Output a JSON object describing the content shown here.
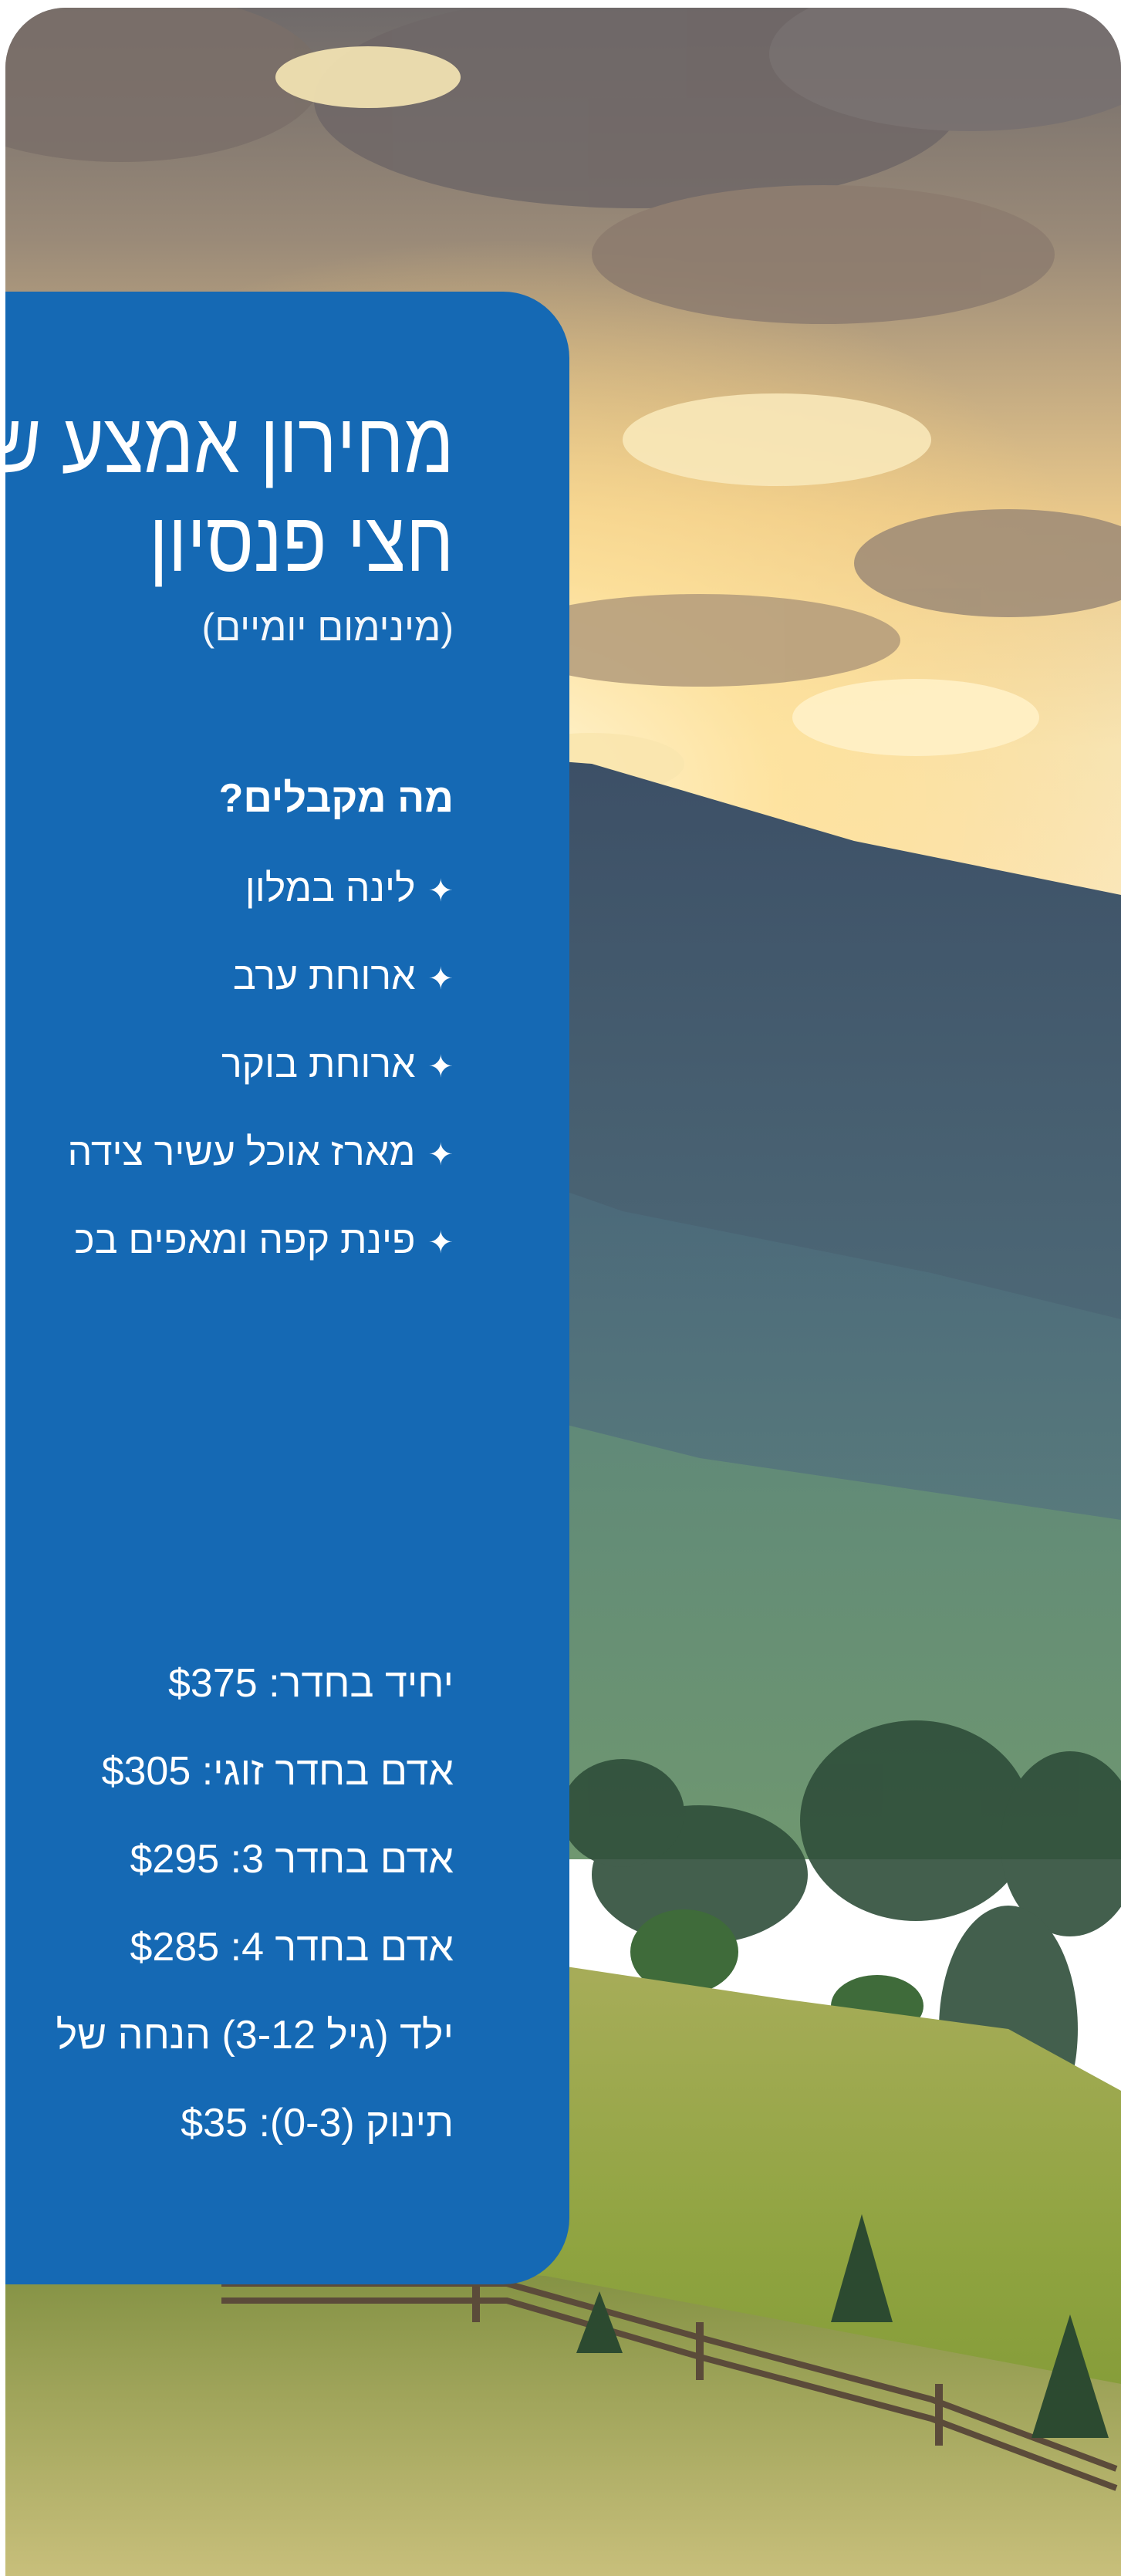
{
  "brand": {
    "panel_color": "#1569b4",
    "text_color": "#ffffff"
  },
  "header": {
    "title_line1": "מחירון אמצע ש",
    "title_line2": "חצי פנסיון",
    "subtitle": "(מינימום יומיים)"
  },
  "features": {
    "heading": "מה מקבלים?",
    "bullet_icon": "sparkle-star-icon",
    "bullet_char": "✦",
    "items": [
      {
        "label": "לינה במלון"
      },
      {
        "label": "ארוחת ערב"
      },
      {
        "label": "ארוחת בוקר"
      },
      {
        "label": "מארז אוכל עשיר צידה"
      },
      {
        "label": "פינת קפה ומאפים בכ"
      }
    ]
  },
  "prices": {
    "items": [
      {
        "label": "יחיד בחדר: $375"
      },
      {
        "label": "אדם בחדר זוגי: $305"
      },
      {
        "label": "אדם בחדר 3: $295"
      },
      {
        "label": "אדם בחדר 4: $285"
      },
      {
        "label": "ילד (גיל 3-12) הנחה של"
      },
      {
        "label": "תינוק (0-3): $35"
      }
    ]
  },
  "background": {
    "scene": "mountain-sunset-meadow-photo"
  }
}
